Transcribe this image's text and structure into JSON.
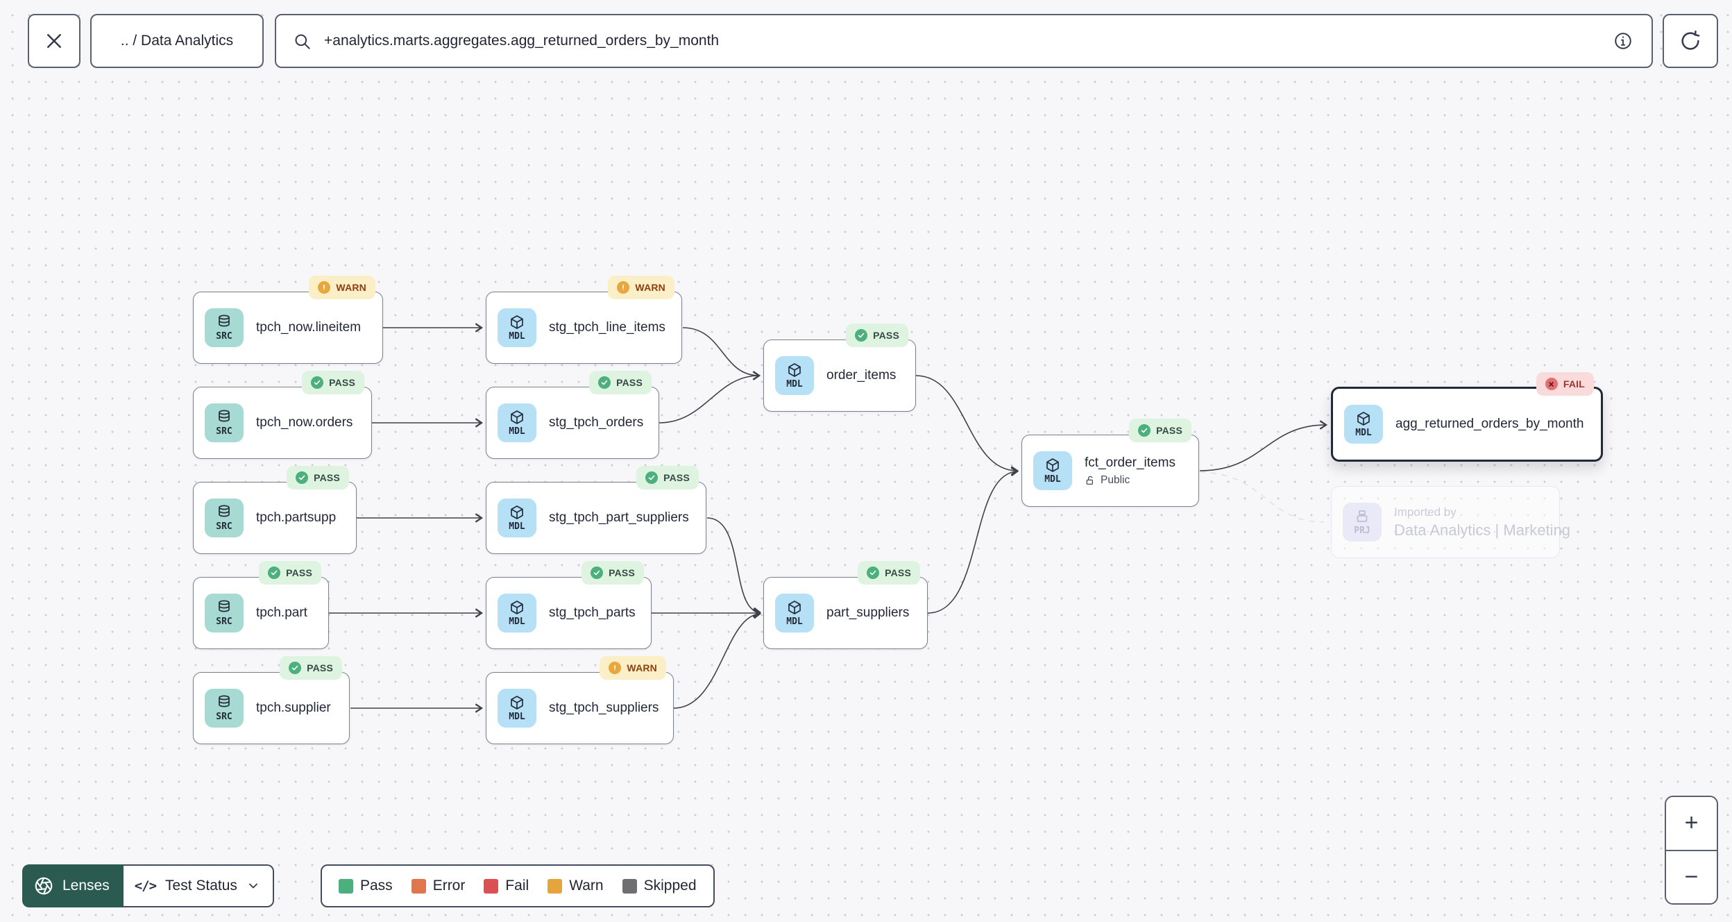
{
  "header": {
    "breadcrumb": ".. / Data Analytics",
    "search_value": "+analytics.marts.aggregates.agg_returned_orders_by_month",
    "icons": {
      "close": "close-icon",
      "search": "magnifier-icon",
      "info": "info-icon",
      "refresh": "refresh-icon"
    }
  },
  "nodes": [
    {
      "id": "tpch_now.lineitem",
      "type": "SRC",
      "label": "tpch_now.lineitem",
      "status": "WARN"
    },
    {
      "id": "stg_tpch_line_items",
      "type": "MDL",
      "label": "stg_tpch_line_items",
      "status": "WARN"
    },
    {
      "id": "tpch_now.orders",
      "type": "SRC",
      "label": "tpch_now.orders",
      "status": "PASS"
    },
    {
      "id": "stg_tpch_orders",
      "type": "MDL",
      "label": "stg_tpch_orders",
      "status": "PASS"
    },
    {
      "id": "order_items",
      "type": "MDL",
      "label": "order_items",
      "status": "PASS"
    },
    {
      "id": "tpch.partsupp",
      "type": "SRC",
      "label": "tpch.partsupp",
      "status": "PASS"
    },
    {
      "id": "stg_tpch_part_suppliers",
      "type": "MDL",
      "label": "stg_tpch_part_suppliers",
      "status": "PASS"
    },
    {
      "id": "tpch.part",
      "type": "SRC",
      "label": "tpch.part",
      "status": "PASS"
    },
    {
      "id": "stg_tpch_parts",
      "type": "MDL",
      "label": "stg_tpch_parts",
      "status": "PASS"
    },
    {
      "id": "part_suppliers",
      "type": "MDL",
      "label": "part_suppliers",
      "status": "PASS"
    },
    {
      "id": "tpch.supplier",
      "type": "SRC",
      "label": "tpch.supplier",
      "status": "PASS"
    },
    {
      "id": "stg_tpch_suppliers",
      "type": "MDL",
      "label": "stg_tpch_suppliers",
      "status": "WARN"
    },
    {
      "id": "fct_order_items",
      "type": "MDL",
      "label": "fct_order_items",
      "status": "PASS",
      "access": "Public"
    },
    {
      "id": "agg_returned_orders_by_month",
      "type": "MDL",
      "label": "agg_returned_orders_by_month",
      "status": "FAIL",
      "selected": true
    }
  ],
  "ghost_node": {
    "type": "PRJ",
    "title": "Imported by",
    "subtitle": "Data Analytics | Marketing"
  },
  "controls": {
    "lenses_label": "Lenses",
    "active_lens": "Test Status"
  },
  "legend": {
    "items": [
      {
        "label": "Pass",
        "color": "#4CAF7D"
      },
      {
        "label": "Error",
        "color": "#E0764C"
      },
      {
        "label": "Fail",
        "color": "#DB5151"
      },
      {
        "label": "Warn",
        "color": "#E5A53C"
      },
      {
        "label": "Skipped",
        "color": "#6E6E73"
      }
    ]
  },
  "zoom": {
    "in": "+",
    "out": "−"
  },
  "status_badge_colors": {
    "pass_bg": "#DEF4E1",
    "warn_bg": "#FAEFC6",
    "fail_bg": "#F9DBDB"
  }
}
